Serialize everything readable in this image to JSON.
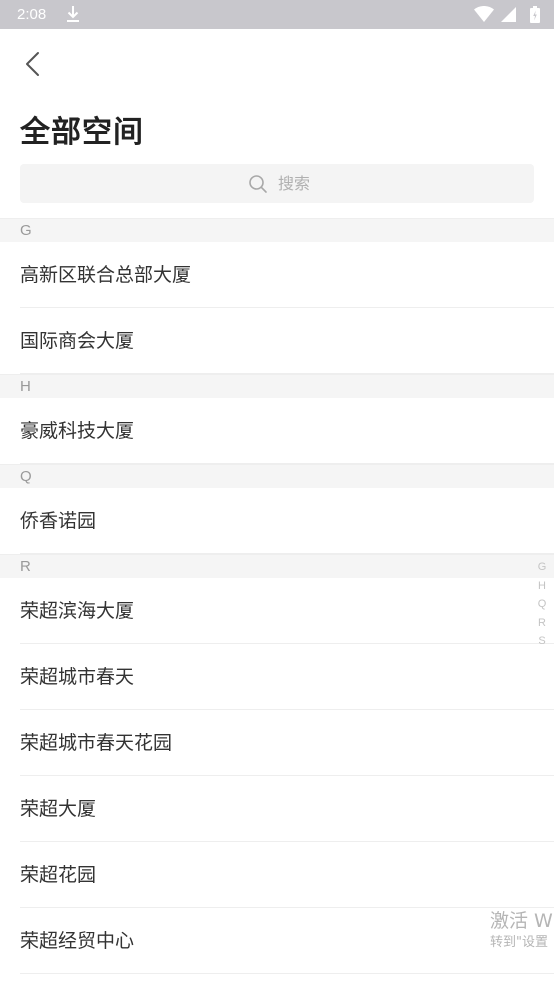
{
  "status_bar": {
    "time": "2:08",
    "icons": [
      "download-icon",
      "wifi-icon",
      "signal-icon",
      "battery-icon"
    ]
  },
  "header": {
    "title": "全部空间"
  },
  "search": {
    "placeholder": "搜索"
  },
  "sections": [
    {
      "letter": "G",
      "items": [
        "高新区联合总部大厦",
        "国际商会大厦"
      ]
    },
    {
      "letter": "H",
      "items": [
        "豪威科技大厦"
      ]
    },
    {
      "letter": "Q",
      "items": [
        "侨香诺园"
      ]
    },
    {
      "letter": "R",
      "items": [
        "荣超滨海大厦",
        "荣超城市春天",
        "荣超城市春天花园",
        "荣超大厦",
        "荣超花园",
        "荣超经贸中心"
      ]
    }
  ],
  "index_bar": [
    "G",
    "H",
    "Q",
    "R",
    "S"
  ],
  "watermark": {
    "title": "激活 W",
    "subtitle": "转到\"设置"
  },
  "colors": {
    "status_bar": "#c8c7cc",
    "section_header_bg": "#f5f5f5",
    "search_bg": "#f4f4f4"
  }
}
